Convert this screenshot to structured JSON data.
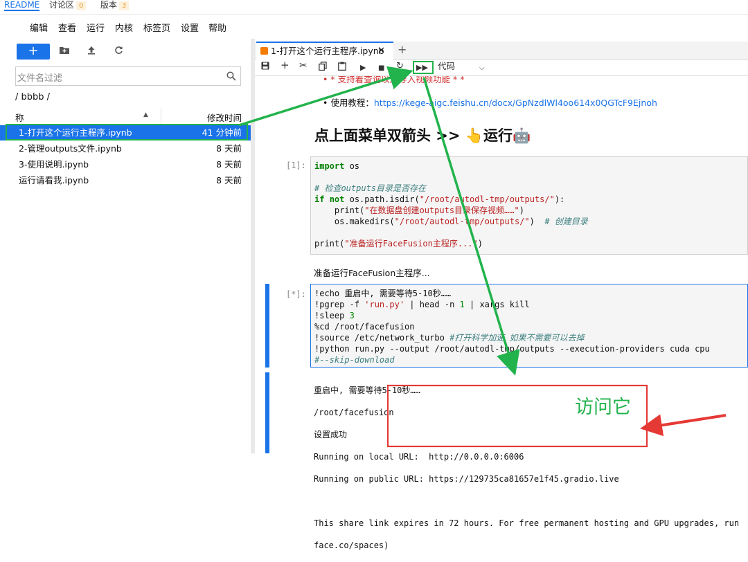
{
  "toptabs": {
    "readme": "README",
    "discussion": "讨论区",
    "discussion_count": "0",
    "version": "版本",
    "version_count": "3"
  },
  "menu": [
    "编辑",
    "查看",
    "运行",
    "内核",
    "标签页",
    "设置",
    "帮助"
  ],
  "filebrowser": {
    "new_label": "+",
    "filter_placeholder": "文件名过滤",
    "breadcrumb": "/ bbbb /",
    "col_name": "称",
    "col_modified": "修改时间",
    "files": [
      {
        "name": "1-打开这个运行主程序.ipynb",
        "time": "41 分钟前"
      },
      {
        "name": "2-管理outputs文件.ipynb",
        "time": "8 天前"
      },
      {
        "name": "3-使用说明.ipynb",
        "time": "8 天前"
      },
      {
        "name": "运行请看我.ipynb",
        "time": "8 天前"
      }
    ]
  },
  "notebook": {
    "tab_title": "1-打开这个运行主程序.ipynb",
    "add_tab": "+",
    "cell_type": "代码",
    "top_partial": "* 支持着查询以及导入视频功能 * *",
    "tutorial_label": "使用教程：",
    "tutorial_url": "https://kege-aigc.feishu.cn/docx/GpNzdlWl4oo614x0QGTcF9Ejnoh",
    "heading": "点上面菜单双箭头 >> 👆运行🤖",
    "cell1_prompt": "[1]:",
    "cell1_output": "准备运行FaceFusion主程序...",
    "cell2_prompt": "[*]:",
    "output2_lines": [
      "重启中, 需要等待5-10秒……",
      "/root/facefusion",
      "设置成功",
      "Running on local URL:  http://0.0.0.0:6006",
      "Running on public URL: https://129735ca81657e1f45.gradio.live",
      "",
      "This share link expires in 72 hours. For free permanent hosting and GPU upgrades, run",
      "face.co/spaces)"
    ]
  },
  "annotation": {
    "callout": "访问它",
    "green": "#22b34c",
    "red": "#e53935"
  },
  "colors": {
    "accent": "#1a73e8"
  }
}
